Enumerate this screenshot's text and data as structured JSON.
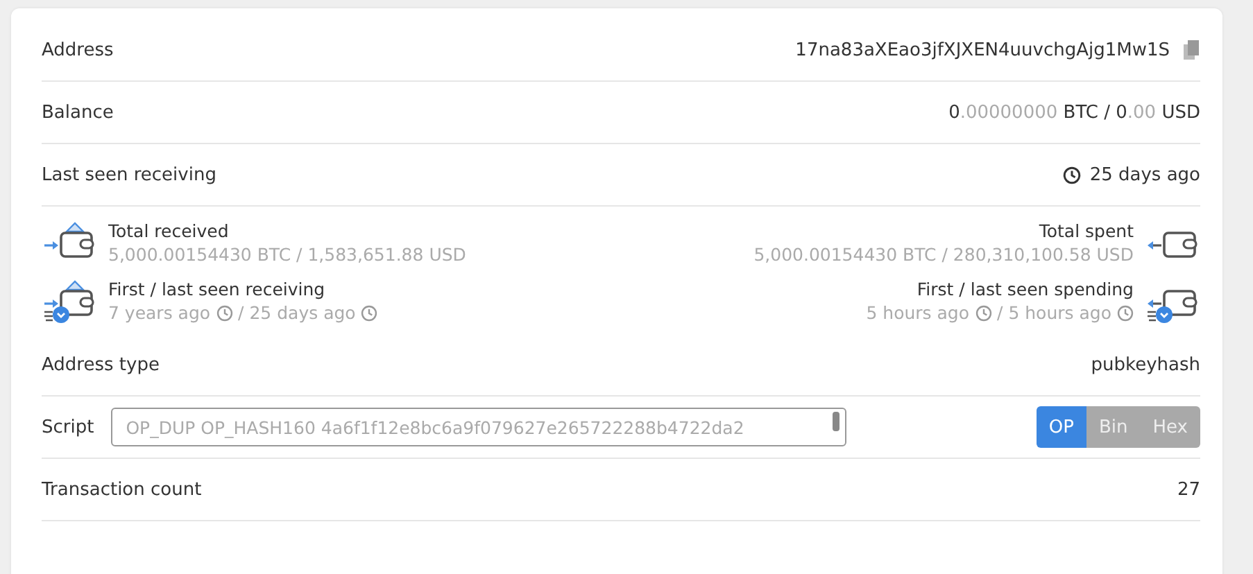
{
  "rows_top": [
    {
      "kind": "address",
      "label": "Address",
      "value": "17na83aXEao3jfXJXEN4uuvchgAjg1Mw1S"
    },
    {
      "kind": "balance",
      "label": "Balance",
      "segments": [
        {
          "text": "0",
          "muted": false
        },
        {
          "text": ".00000000",
          "muted": true
        },
        {
          "text": " BTC / 0",
          "muted": false
        },
        {
          "text": ".00",
          "muted": true
        },
        {
          "text": " USD",
          "muted": false
        }
      ]
    },
    {
      "kind": "time",
      "label": "Last seen receiving",
      "value": "25 days ago"
    }
  ],
  "stats": [
    {
      "kind": "in",
      "title": "Total received",
      "value": "5,000.00154430 BTC / 1,583,651.88 USD"
    },
    {
      "kind": "out",
      "title": "Total spent",
      "value": "5,000.00154430 BTC / 280,310,100.58 USD"
    },
    {
      "kind": "in-time",
      "title": "First / last seen receiving",
      "times": [
        "7 years ago",
        "/ 25 days ago"
      ]
    },
    {
      "kind": "out-time",
      "title": "First / last seen spending",
      "times": [
        "5 hours ago",
        "/ 5 hours ago"
      ]
    }
  ],
  "address_type": {
    "label": "Address type",
    "value": "pubkeyhash"
  },
  "script": {
    "label": "Script",
    "value": "OP_DUP OP_HASH160 4a6f1f12e8bc6a9f079627e265722288b4722da2",
    "formats": [
      {
        "label": "OP",
        "selected": true
      },
      {
        "label": "Bin",
        "selected": false
      },
      {
        "label": "Hex",
        "selected": false
      }
    ]
  },
  "transaction_count": {
    "label": "Transaction count",
    "value": "27"
  }
}
